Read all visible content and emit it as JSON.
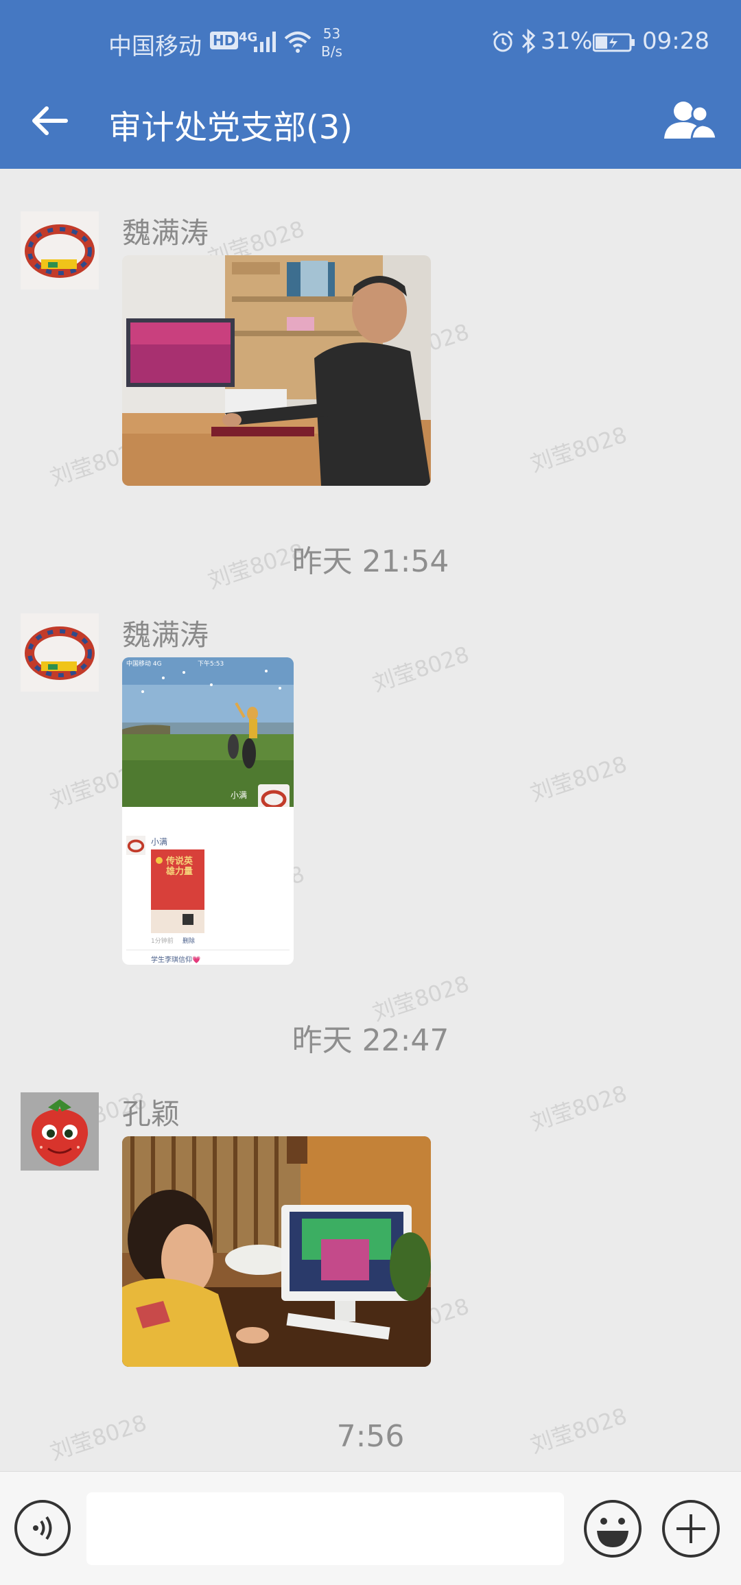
{
  "status_bar": {
    "carrier": "中国移动",
    "hd": "HD",
    "network": "4G",
    "speed_value": "53",
    "speed_unit": "B/s",
    "battery": "31%",
    "time": "09:28"
  },
  "header": {
    "title": "审计处党支部(3)",
    "back_icon": "arrow-left-icon",
    "members_icon": "group-members-icon",
    "bg_color": "#4578c2"
  },
  "watermark": "刘莹8028",
  "messages": [
    {
      "sender": "魏满涛",
      "type": "image",
      "avatar": "toy-train-avatar",
      "image_desc_icon": "man-at-desk-photo"
    },
    {
      "time": "昨天 21:54"
    },
    {
      "sender": "魏满涛",
      "type": "image",
      "avatar": "toy-train-avatar",
      "image_desc_icon": "moments-screenshot-photo",
      "screenshot_texts": {
        "status_left": "中国移动 4G",
        "status_center": "下午5:53",
        "poster_author": "小满",
        "post_author": "小满",
        "post_time": "1分钟前",
        "post_delete": "删除",
        "commenter": "学生李琪信仰💗",
        "poster_title": "传说英雄力量"
      }
    },
    {
      "time": "昨天 22:47"
    },
    {
      "sender": "孔颖",
      "type": "image",
      "avatar": "strawberry-avatar",
      "image_desc_icon": "woman-at-computer-photo"
    },
    {
      "time": "7:56"
    }
  ],
  "input_bar": {
    "voice_icon": "voice-icon",
    "emoji_icon": "emoji-icon",
    "plus_icon": "plus-icon",
    "placeholder": ""
  }
}
